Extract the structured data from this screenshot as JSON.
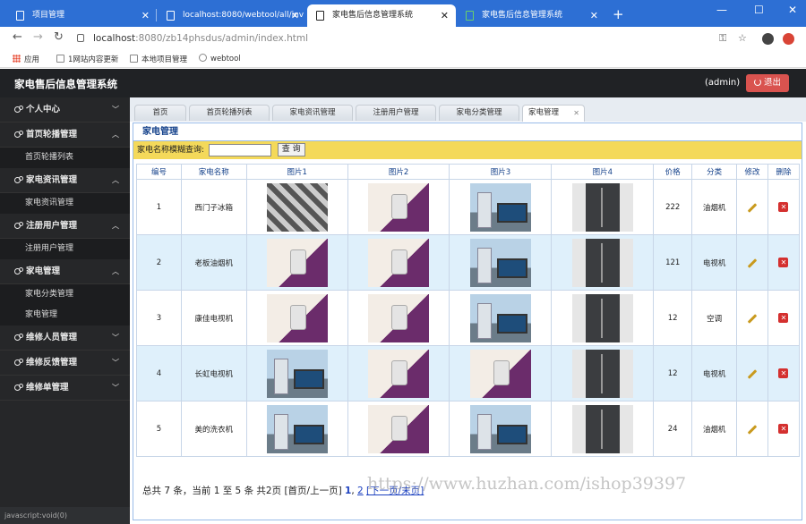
{
  "browser": {
    "tabs": [
      {
        "label": "项目管理"
      },
      {
        "label": "localhost:8080/webtool/all/inv"
      },
      {
        "label": "家电售后信息管理系统"
      },
      {
        "label": "家电售后信息管理系统"
      }
    ],
    "new_tab": "+",
    "url_host": "localhost",
    "url_rest": ":8080/zb14phsdus/admin/index.html",
    "bookmarks": [
      {
        "label": "应用"
      },
      {
        "label": "1网站内容更新"
      },
      {
        "label": "本地项目管理"
      },
      {
        "label": "webtool"
      }
    ]
  },
  "header": {
    "title": "家电售后信息管理系统",
    "user": "(admin)",
    "logout": "退出"
  },
  "sidebar": {
    "groups": [
      {
        "label": "个人中心"
      },
      {
        "label": "首页轮播管理",
        "items": [
          {
            "label": "首页轮播列表"
          }
        ]
      },
      {
        "label": "家电资讯管理",
        "items": [
          {
            "label": "家电资讯管理"
          }
        ]
      },
      {
        "label": "注册用户管理",
        "items": [
          {
            "label": "注册用户管理"
          }
        ]
      },
      {
        "label": "家电管理",
        "items": [
          {
            "label": "家电分类管理"
          },
          {
            "label": "家电管理"
          }
        ]
      },
      {
        "label": "维修人员管理"
      },
      {
        "label": "维修反馈管理"
      },
      {
        "label": "维修单管理"
      }
    ],
    "status": "javascript:void(0)"
  },
  "page_tabs": [
    {
      "label": "首页"
    },
    {
      "label": "首页轮播列表"
    },
    {
      "label": "家电资讯管理"
    },
    {
      "label": "注册用户管理"
    },
    {
      "label": "家电分类管理"
    },
    {
      "label": "家电管理"
    }
  ],
  "panel": {
    "title": "家电管理",
    "search_label": "家电名称模糊查询:",
    "search_value": "",
    "search_button": "查 询"
  },
  "table": {
    "headers": [
      "编号",
      "家电名称",
      "图片1",
      "图片2",
      "图片3",
      "图片4",
      "价格",
      "分类",
      "修改",
      "删除"
    ],
    "rows": [
      {
        "id": "1",
        "name": "西门子冰箱",
        "imgs": [
          "stack",
          "room",
          "lineup",
          "fridge"
        ],
        "price": "222",
        "category": "油烟机"
      },
      {
        "id": "2",
        "name": "老板油烟机",
        "imgs": [
          "room",
          "room",
          "lineup",
          "fridge"
        ],
        "price": "121",
        "category": "电视机"
      },
      {
        "id": "3",
        "name": "康佳电视机",
        "imgs": [
          "room",
          "room",
          "lineup",
          "fridge"
        ],
        "price": "12",
        "category": "空调"
      },
      {
        "id": "4",
        "name": "长虹电视机",
        "imgs": [
          "lineup",
          "room",
          "room",
          "fridge"
        ],
        "price": "12",
        "category": "电视机"
      },
      {
        "id": "5",
        "name": "美的洗衣机",
        "imgs": [
          "lineup",
          "room",
          "lineup",
          "fridge"
        ],
        "price": "24",
        "category": "油烟机"
      }
    ]
  },
  "pager": {
    "summary": "总共 7 条，当前 1 至 5 条 共2页",
    "first_prev": "[首页/上一页]",
    "page1": "1",
    "page2": "2",
    "next_last": "[下一页/末页]"
  },
  "watermark": "https://www.huzhan.com/ishop39397"
}
